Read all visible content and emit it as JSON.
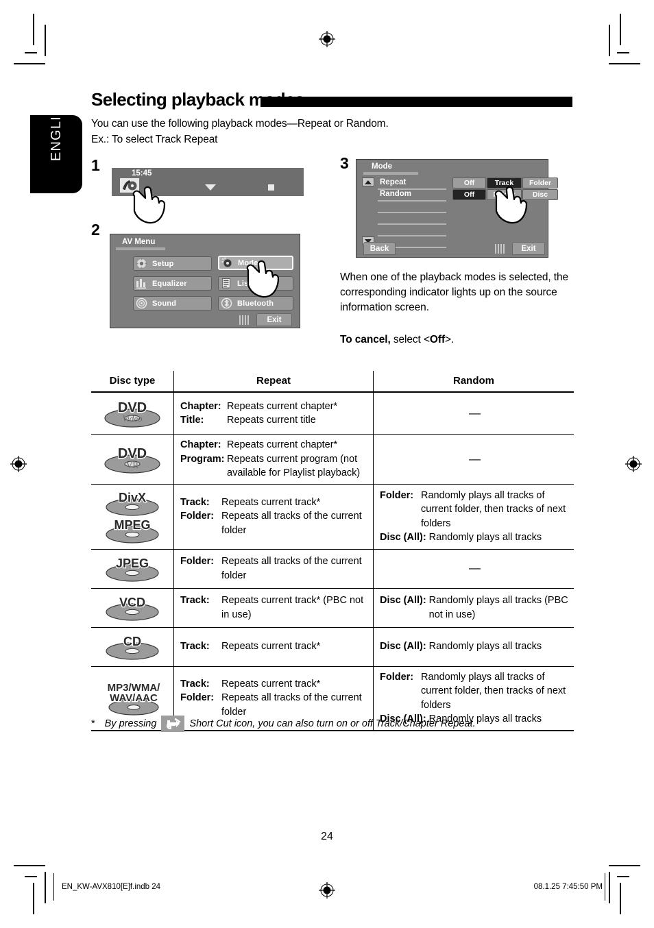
{
  "language_tab": "ENGLISH",
  "heading": {
    "title": "Selecting playback modes"
  },
  "intro": {
    "line1": "You can use the following playback modes—Repeat or Random.",
    "line2": "Ex.: To select Track Repeat"
  },
  "steps": {
    "step1_num": "1",
    "step2_num": "2",
    "step3_num": "3"
  },
  "screen_step1": {
    "clock": "15:45",
    "disc_icon": "disc-source-icon",
    "down_arrow_icon": "chevron-down-icon",
    "stop_icon": "stop-square-icon"
  },
  "screen_step2": {
    "title": "AV Menu",
    "buttons": [
      {
        "label": "Setup",
        "icon": "gear-icon",
        "selected": false
      },
      {
        "label": "Equalizer",
        "icon": "equalizer-icon",
        "selected": false
      },
      {
        "label": "Sound",
        "icon": "speaker-icon",
        "selected": false
      },
      {
        "label": "Mode",
        "icon": "mode-icon",
        "selected": true
      },
      {
        "label": "List",
        "icon": "list-icon",
        "selected": false
      },
      {
        "label": "Bluetooth",
        "icon": "bluetooth-icon",
        "selected": false
      }
    ],
    "exit_label": "Exit"
  },
  "screen_step3": {
    "title": "Mode",
    "rows": [
      {
        "label": "Repeat",
        "options": [
          {
            "label": "Off",
            "selected": false
          },
          {
            "label": "Track",
            "selected": true
          },
          {
            "label": "Folder",
            "selected": false
          }
        ]
      },
      {
        "label": "Random",
        "options": [
          {
            "label": "Off",
            "selected": true
          },
          {
            "label": "Folder",
            "selected": false
          },
          {
            "label": "Disc",
            "selected": false
          }
        ]
      }
    ],
    "back_label": "Back",
    "exit_label": "Exit",
    "scroll_up_icon": "scroll-up-icon",
    "scroll_down_icon": "scroll-down-icon"
  },
  "note": {
    "paragraph": "When one of the playback modes is selected, the corresponding indicator lights up on the source information screen.",
    "cancel_bold": "To cancel,",
    "cancel_rest": " select <",
    "cancel_value": "Off",
    "cancel_end": ">."
  },
  "table": {
    "headers": {
      "disc_type": "Disc type",
      "repeat": "Repeat",
      "random": "Random"
    },
    "rows": [
      {
        "disc": {
          "name": "DVD Video",
          "line1": "DVD",
          "line2": "Video"
        },
        "repeat": [
          {
            "term": "Chapter:",
            "desc": "Repeats current chapter*"
          },
          {
            "term": "Title:",
            "desc": "Repeats current title"
          }
        ],
        "random": "—"
      },
      {
        "disc": {
          "name": "DVD VR",
          "line1": "DVD",
          "line2": "VR"
        },
        "repeat": [
          {
            "term": "Chapter:",
            "desc": "Repeats current chapter*"
          },
          {
            "term": "Program:",
            "desc": "Repeats current program (not available for Playlist playback)"
          }
        ],
        "random": "—"
      },
      {
        "disc": {
          "name": "DivX / MPEG",
          "line1": "DivX",
          "line2": "MPEG"
        },
        "repeat": [
          {
            "term": "Track:",
            "desc": "Repeats current track*"
          },
          {
            "term": "Folder:",
            "desc": "Repeats all tracks of the current folder"
          }
        ],
        "random_items": [
          {
            "term": "Folder:",
            "desc": "Randomly plays all tracks of current folder, then tracks of next folders"
          },
          {
            "term": "Disc (All):",
            "desc": "Randomly plays all tracks"
          }
        ]
      },
      {
        "disc": {
          "name": "JPEG",
          "line1": "JPEG",
          "line2": ""
        },
        "repeat": [
          {
            "term": "Folder:",
            "desc": "Repeats all tracks of the current folder"
          }
        ],
        "random": "—"
      },
      {
        "disc": {
          "name": "VCD",
          "line1": "VCD",
          "line2": ""
        },
        "repeat": [
          {
            "term": "Track:",
            "desc": "Repeats current track* (PBC not in use)"
          }
        ],
        "random_items": [
          {
            "term": "Disc (All):",
            "desc": "Randomly plays all tracks (PBC not in use)"
          }
        ]
      },
      {
        "disc": {
          "name": "CD",
          "line1": "CD",
          "line2": ""
        },
        "repeat": [
          {
            "term": "Track:",
            "desc": "Repeats current track*"
          }
        ],
        "random_items": [
          {
            "term": "Disc (All):",
            "desc": "Randomly plays all tracks"
          }
        ]
      },
      {
        "disc": {
          "name": "MP3/WMA/WAV/AAC",
          "line1": "MP3/WMA/",
          "line2": "WAV/AAC"
        },
        "repeat": [
          {
            "term": "Track:",
            "desc": "Repeats current track*"
          },
          {
            "term": "Folder:",
            "desc": "Repeats all tracks of the current folder"
          }
        ],
        "random_items": [
          {
            "term": "Folder:",
            "desc": "Randomly plays all tracks of current folder, then tracks of next folders"
          },
          {
            "term": "Disc (All):",
            "desc": "Randomly plays all tracks"
          }
        ]
      }
    ]
  },
  "footnote": {
    "star": "*",
    "text_before": "By pressing",
    "icon": "short-cut-icon",
    "text_after": "Short Cut icon, you can also turn on or off Track/Chapter Repeat."
  },
  "page_number": "24",
  "footer": {
    "left": "EN_KW-AVX810[E]f.indb   24",
    "right": "08.1.25   7:45:50 PM"
  }
}
